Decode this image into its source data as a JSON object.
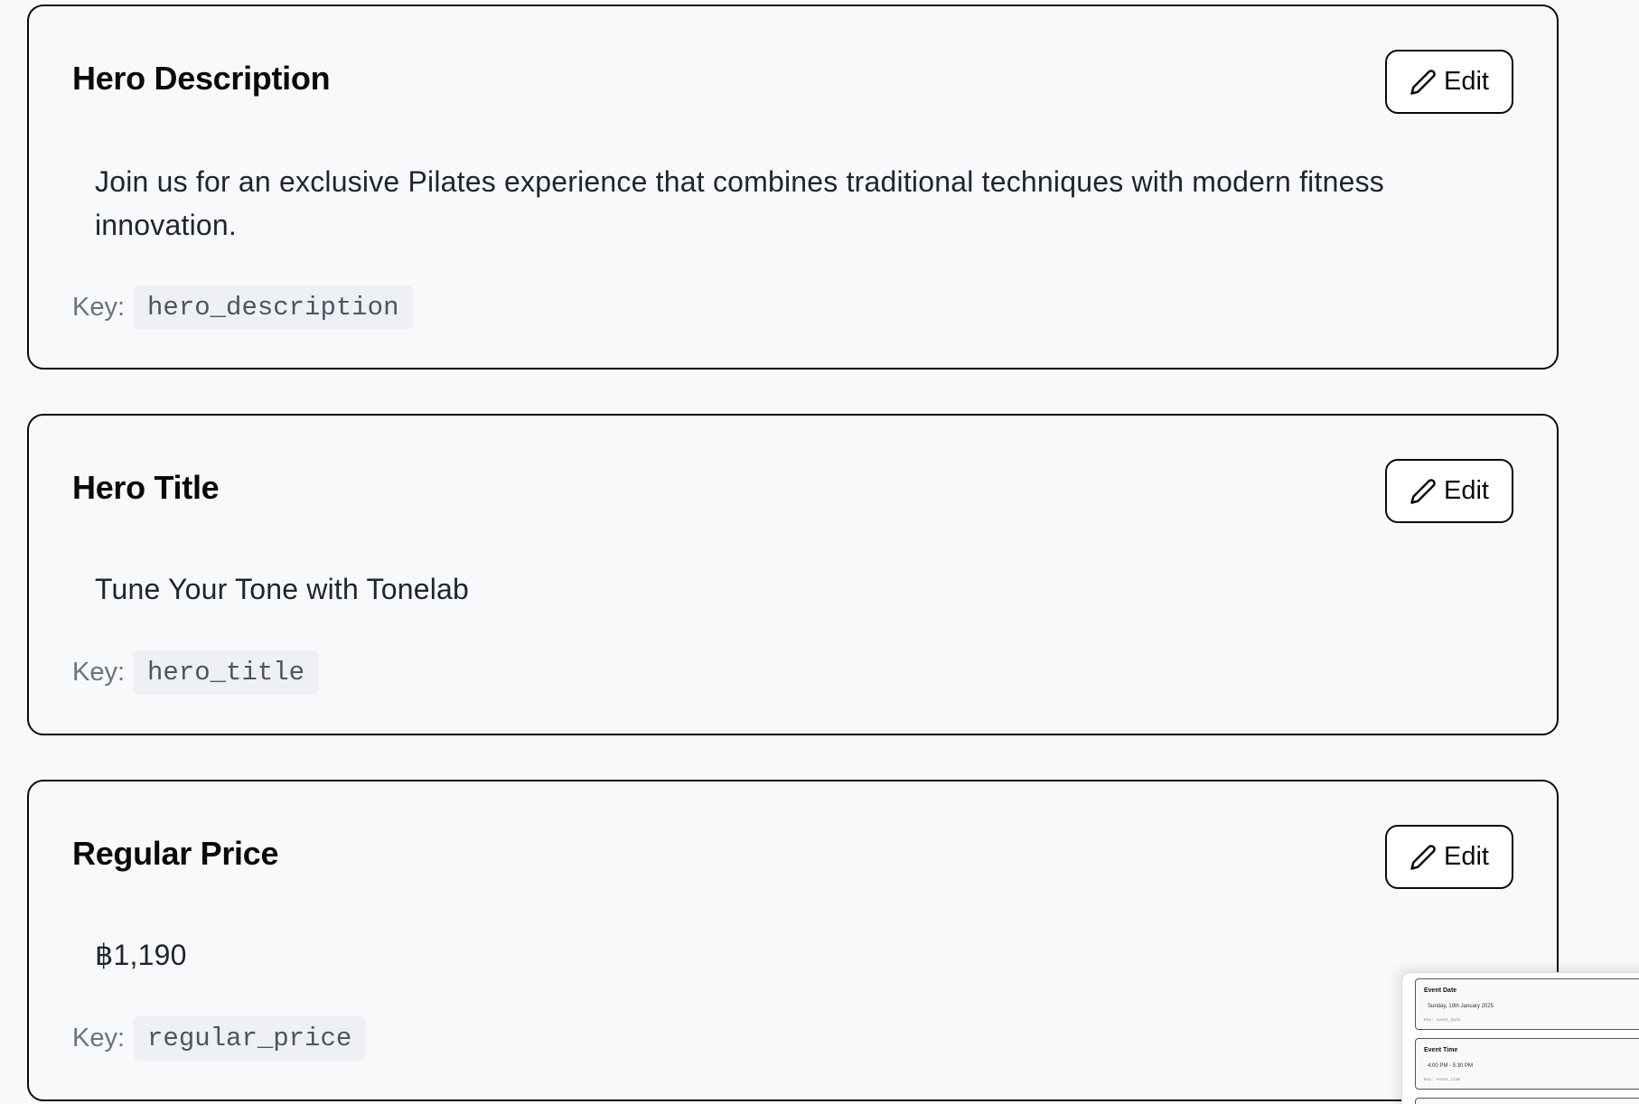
{
  "edit_label": "Edit",
  "key_label": "Key:",
  "cards": [
    {
      "title": "Hero Description",
      "value": "Join us for an exclusive Pilates experience that combines traditional techniques with modern fitness innovation.",
      "key": "hero_description"
    },
    {
      "title": "Hero Title",
      "value": "Tune Your Tone with Tonelab",
      "key": "hero_title"
    },
    {
      "title": "Regular Price",
      "value": "฿1,190",
      "key": "regular_price"
    }
  ],
  "preview": {
    "cards": [
      {
        "title": "Event Date",
        "value": "Sunday, 19th January 2025",
        "key": "Key: event_date"
      },
      {
        "title": "Event Time",
        "value": "4:00 PM - 5:30 PM",
        "key": "Key: event_time"
      }
    ]
  }
}
